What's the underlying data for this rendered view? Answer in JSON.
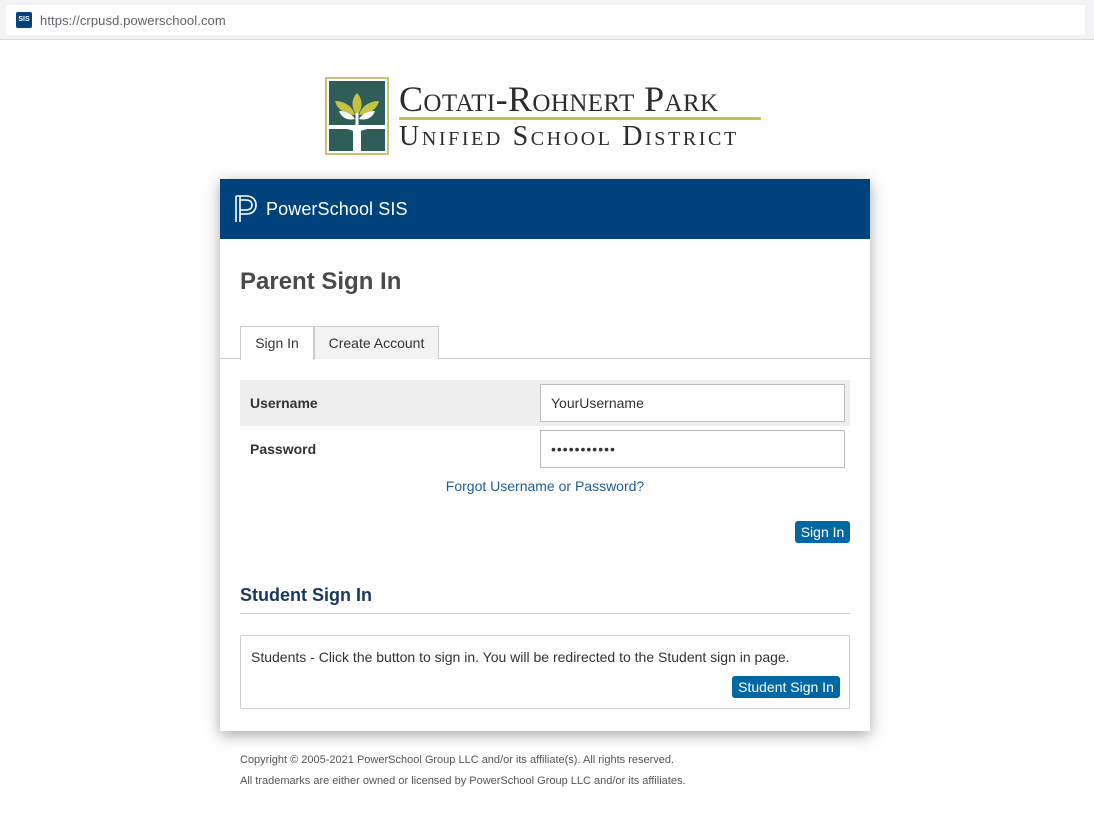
{
  "browser": {
    "favicon_text": "SIS",
    "url": "https://crpusd.powerschool.com"
  },
  "district_logo": {
    "line1": "Cotati-Rohnert Park",
    "line2": "Unified School District",
    "colors": {
      "mark_bg": "#2f5d57",
      "leaf": "#c7c243",
      "rule": "#c6c054"
    }
  },
  "header": {
    "brand": "PowerSchool SIS",
    "bg_color": "#00427c"
  },
  "parent_sign_in": {
    "title": "Parent Sign In",
    "tabs": [
      {
        "label": "Sign In",
        "active": true
      },
      {
        "label": "Create Account",
        "active": false
      }
    ],
    "username_label": "Username",
    "username_value": "YourUsername",
    "password_label": "Password",
    "password_value": "•••••••••••",
    "forgot_link": "Forgot Username or Password?",
    "sign_in_button": "Sign In"
  },
  "student_sign_in": {
    "title": "Student Sign In",
    "description": "Students - Click the button to sign in. You will be redirected to the Student sign in page.",
    "button": "Student Sign In"
  },
  "footer": {
    "copyright": "Copyright © 2005-2021 PowerSchool Group LLC and/or its affiliate(s). All rights reserved.",
    "trademarks": "All trademarks are either owned or licensed by PowerSchool Group LLC and/or its affiliates."
  },
  "accent_color": "#0067a5"
}
